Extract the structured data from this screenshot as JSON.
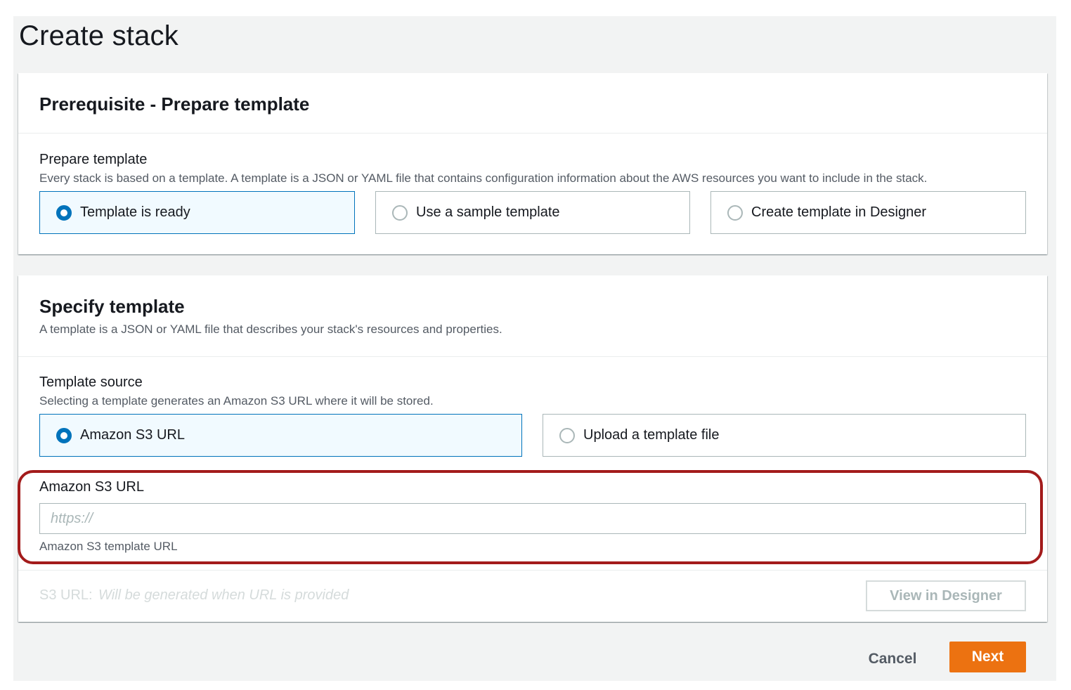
{
  "page": {
    "title": "Create stack"
  },
  "prerequisite": {
    "title": "Prerequisite - Prepare template",
    "field_label": "Prepare template",
    "field_desc": "Every stack is based on a template. A template is a JSON or YAML file that contains configuration information about the AWS resources you want to include in the stack.",
    "options": [
      {
        "label": "Template is ready",
        "selected": true
      },
      {
        "label": "Use a sample template",
        "selected": false
      },
      {
        "label": "Create template in Designer",
        "selected": false
      }
    ]
  },
  "specify": {
    "title": "Specify template",
    "desc": "A template is a JSON or YAML file that describes your stack's resources and properties.",
    "source_label": "Template source",
    "source_desc": "Selecting a template generates an Amazon S3 URL where it will be stored.",
    "options": [
      {
        "label": "Amazon S3 URL",
        "selected": true
      },
      {
        "label": "Upload a template file",
        "selected": false
      }
    ],
    "url_field": {
      "label": "Amazon S3 URL",
      "placeholder": "https://",
      "value": "",
      "hint": "Amazon S3 template URL"
    },
    "s3url": {
      "label": "S3 URL:",
      "value": "Will be generated when URL is provided"
    },
    "view_designer_label": "View in Designer"
  },
  "actions": {
    "cancel_label": "Cancel",
    "next_label": "Next"
  },
  "colors": {
    "accent": "#0073bb",
    "primary_button": "#ec7211",
    "highlight": "#a31b1b"
  }
}
